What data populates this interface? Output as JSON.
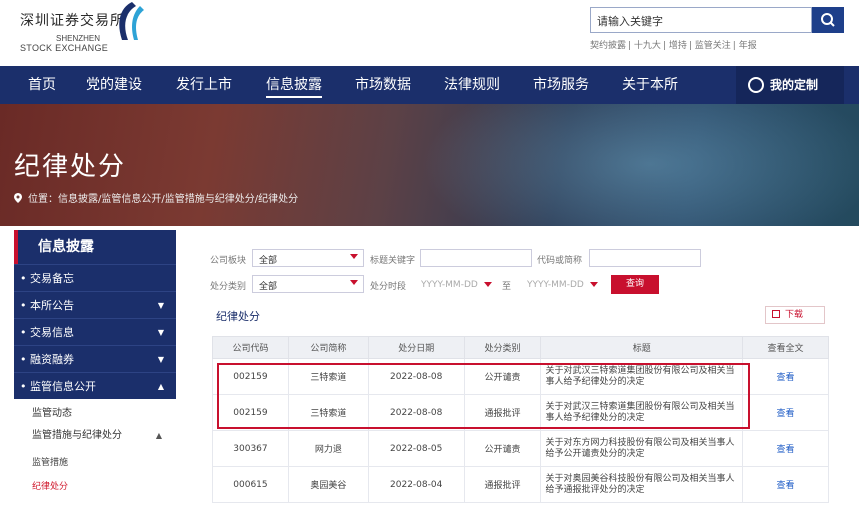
{
  "header": {
    "logo_cn": "深圳证券交易所",
    "logo_en1": "SHENZHEN",
    "logo_en2": "STOCK EXCHANGE",
    "search_placeholder": "请输入关键字",
    "hot_links": [
      "契约披露",
      "十九大",
      "增持",
      "监管关注",
      "年报"
    ]
  },
  "nav": {
    "items": [
      "首页",
      "党的建设",
      "发行上市",
      "信息披露",
      "市场数据",
      "法律规则",
      "市场服务",
      "关于本所"
    ],
    "active": "信息披露",
    "custom_label": "我的定制"
  },
  "banner": {
    "title": "纪律处分",
    "breadcrumb": "位置：信息披露/监管信息公开/监管措施与纪律处分/纪律处分"
  },
  "sidebar": {
    "heading": "信息披露",
    "items": [
      {
        "label": "交易备忘",
        "chevron": ""
      },
      {
        "label": "本所公告",
        "chevron": "▼"
      },
      {
        "label": "交易信息",
        "chevron": "▼"
      },
      {
        "label": "融资融券",
        "chevron": "▼"
      },
      {
        "label": "监管信息公开",
        "chevron": "▲"
      }
    ],
    "sub_items": [
      {
        "label": "监管动态",
        "chevron": ""
      },
      {
        "label": "监管措施与纪律处分",
        "chevron": "▲"
      }
    ],
    "subsub_items": [
      "监管措施",
      "纪律处分"
    ]
  },
  "filters": {
    "company_board_label": "公司板块",
    "company_board_value": "全部",
    "title_keyword_label": "标题关键字",
    "code_label": "代码或简称",
    "type_label": "处分类别",
    "type_value": "全部",
    "time_label": "处分时段",
    "date_start": "YYYY-MM-DD",
    "to_label": "至",
    "date_end": "YYYY-MM-DD",
    "query_label": "查询"
  },
  "list": {
    "section_title": "纪律处分",
    "download_label": "下载",
    "columns": [
      "公司代码",
      "公司简称",
      "处分日期",
      "处分类别",
      "标题",
      "查看全文"
    ],
    "rows": [
      {
        "code": "002159",
        "name": "三特索道",
        "date": "2022-08-08",
        "type": "公开谴责",
        "title": "关于对武汉三特索道集团股份有限公司及相关当事人给予纪律处分的决定",
        "view": "查看"
      },
      {
        "code": "002159",
        "name": "三特索道",
        "date": "2022-08-08",
        "type": "通报批评",
        "title": "关于对武汉三特索道集团股份有限公司及相关当事人给予纪律处分的决定",
        "view": "查看"
      },
      {
        "code": "300367",
        "name": "网力退",
        "date": "2022-08-05",
        "type": "公开谴责",
        "title": "关于对东方网力科技股份有限公司及相关当事人给予公开谴责处分的决定",
        "view": "查看"
      },
      {
        "code": "000615",
        "name": "奥园美谷",
        "date": "2022-08-04",
        "type": "通报批评",
        "title": "关于对奥园美谷科技股份有限公司及相关当事人给予通报批评处分的决定",
        "view": "查看"
      }
    ]
  }
}
